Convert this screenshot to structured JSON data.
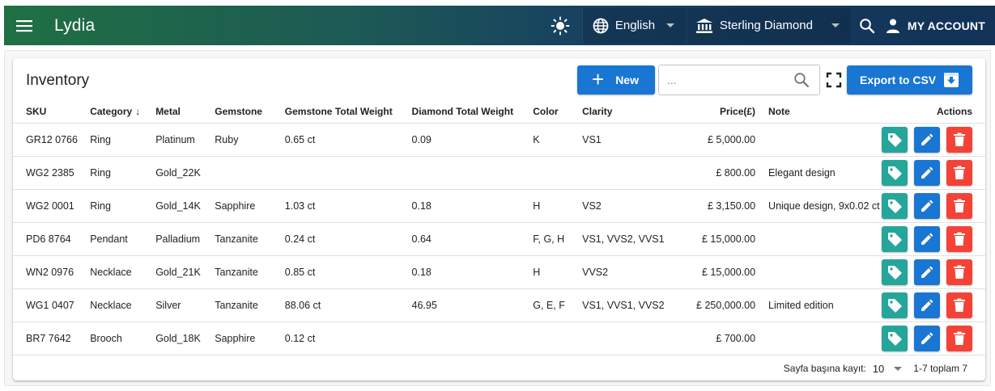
{
  "appbar": {
    "title": "Lydia",
    "language": "English",
    "store": "Sterling Diamond",
    "account_label": "MY ACCOUNT"
  },
  "inventory": {
    "title": "Inventory",
    "new_label": "New",
    "search_placeholder": "...",
    "export_label": "Export to CSV",
    "columns": {
      "sku": "SKU",
      "category": "Category",
      "metal": "Metal",
      "gemstone": "Gemstone",
      "gemstone_weight": "Gemstone Total Weight",
      "diamond_weight": "Diamond Total Weight",
      "color": "Color",
      "clarity": "Clarity",
      "price": "Price(£)",
      "note": "Note",
      "actions": "Actions"
    },
    "sort_indicator": "↓",
    "rows": [
      {
        "sku": "GR12 0766",
        "category": "Ring",
        "metal": "Platinum",
        "gemstone": "Ruby",
        "gemstone_weight": "0.65 ct",
        "diamond_weight": "0.09",
        "color": "K",
        "clarity": "VS1",
        "price": "£ 5,000.00",
        "note": ""
      },
      {
        "sku": "WG2 2385",
        "category": "Ring",
        "metal": "Gold_22K",
        "gemstone": "",
        "gemstone_weight": "",
        "diamond_weight": "",
        "color": "",
        "clarity": "",
        "price": "£ 800.00",
        "note": "Elegant design"
      },
      {
        "sku": "WG2 0001",
        "category": "Ring",
        "metal": "Gold_14K",
        "gemstone": "Sapphire",
        "gemstone_weight": "1.03 ct",
        "diamond_weight": "0.18",
        "color": "H",
        "clarity": "VS2",
        "price": "£ 3,150.00",
        "note": "Unique design, 9x0.02 ct"
      },
      {
        "sku": "PD6 8764",
        "category": "Pendant",
        "metal": "Palladium",
        "gemstone": "Tanzanite",
        "gemstone_weight": "0.24 ct",
        "diamond_weight": "0.64",
        "color": "F, G, H",
        "clarity": "VS1, VVS2, VVS1",
        "price": "£ 15,000.00",
        "note": ""
      },
      {
        "sku": "WN2 0976",
        "category": "Necklace",
        "metal": "Gold_21K",
        "gemstone": "Tanzanite",
        "gemstone_weight": "0.85 ct",
        "diamond_weight": "0.18",
        "color": "H",
        "clarity": "VVS2",
        "price": "£ 15,000.00",
        "note": ""
      },
      {
        "sku": "WG1 0407",
        "category": "Necklace",
        "metal": "Silver",
        "gemstone": "Tanzanite",
        "gemstone_weight": "88.06 ct",
        "diamond_weight": "46.95",
        "color": "G, E, F",
        "clarity": "VS1, VVS1, VVS2",
        "price": "£ 250,000.00",
        "note": "Limited edition"
      },
      {
        "sku": "BR7 7642",
        "category": "Brooch",
        "metal": "Gold_18K",
        "gemstone": "Sapphire",
        "gemstone_weight": "0.12 ct",
        "diamond_weight": "",
        "color": "",
        "clarity": "",
        "price": "£ 700.00",
        "note": ""
      }
    ],
    "footer": {
      "rows_per_page_label": "Sayfa başına kayıt:",
      "rows_per_page_value": "10",
      "range_label": "1-7 toplam 7"
    }
  },
  "icons": {
    "menu": "menu-icon",
    "theme": "sun-icon",
    "language": "globe-icon",
    "store": "bank-icon",
    "search": "search-icon",
    "account": "person-icon",
    "fullscreen": "fullscreen-icon",
    "export": "download-box-icon",
    "tag": "tag-icon",
    "edit": "pencil-icon",
    "delete": "trash-icon"
  },
  "colors": {
    "primary": "#1976d2",
    "tag_button": "#26a69a",
    "delete_button": "#f44336",
    "appbar_start": "#1f7043",
    "appbar_end": "#123257"
  }
}
